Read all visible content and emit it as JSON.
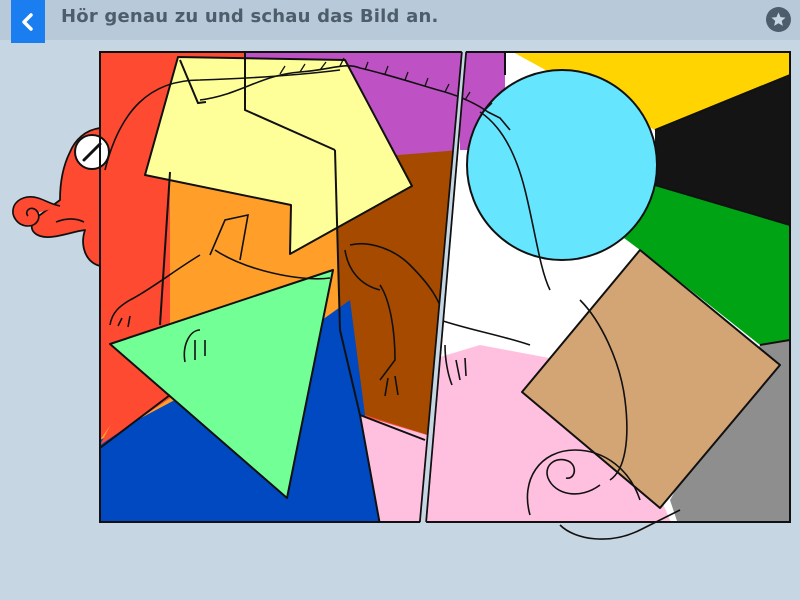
{
  "header": {
    "instruction": "Hör genau zu und schau das Bild an."
  },
  "icons": {
    "back": "chevron-left-icon",
    "favorite": "star-icon"
  },
  "colors": {
    "background": "#c7d6e3",
    "topbar": "#b8c9d9",
    "accent": "#1a7ef0",
    "text": "#4e5d6b",
    "red": "#ff4a32",
    "purple": "#be52c4",
    "yellow": "#ffd400",
    "black": "#141414",
    "green": "#00a314",
    "gray": "#8e8e8e",
    "pink": "#ffc0e0",
    "blue": "#0049c0",
    "brown": "#a64a00",
    "orange": "#ff9f2a",
    "light_yellow": "#ffff99",
    "light_green": "#72ff96",
    "light_blue": "#66e5ff",
    "tan": "#d4a574",
    "white": "#ffffff"
  },
  "puzzle": {
    "pieces": [
      "left-panel",
      "right-panel"
    ],
    "shapes": [
      "arrow",
      "triangle",
      "circle",
      "square"
    ],
    "animal": "chameleon"
  }
}
